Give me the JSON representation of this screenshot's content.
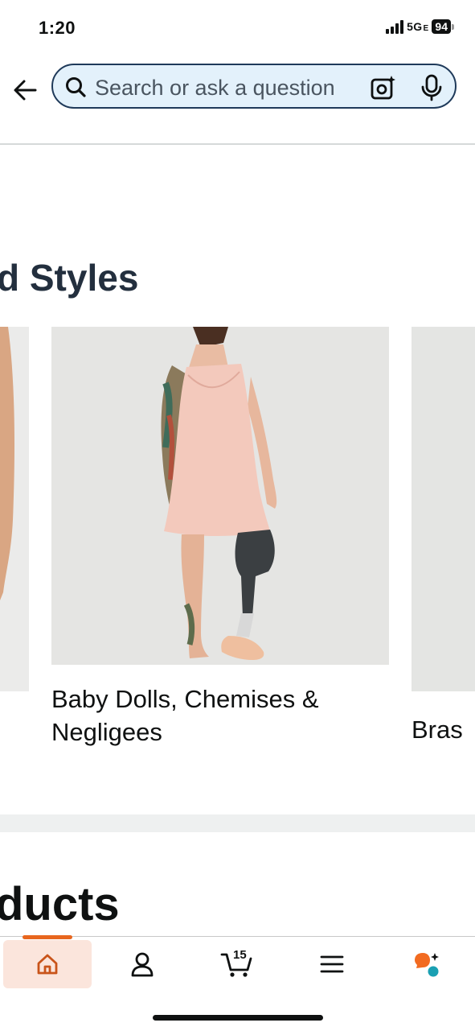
{
  "status_bar": {
    "time": "1:20",
    "network": "5G",
    "network_suffix": "E",
    "battery": "94"
  },
  "search": {
    "placeholder": "Search or ask a question",
    "accent": "#1f3a5a",
    "background": "#e3f1fb"
  },
  "sections": {
    "styles_title": "d Styles",
    "products_title": "ducts"
  },
  "carousel": {
    "items": [
      {
        "label": "Baby Dolls, Chemises & Negligees",
        "icon": "sleepwear-product-image"
      },
      {
        "label": "Bras",
        "icon": "bras-product-image"
      }
    ]
  },
  "bottom_nav": {
    "items": [
      {
        "name": "home",
        "icon": "home-icon",
        "active": true
      },
      {
        "name": "account",
        "icon": "person-icon"
      },
      {
        "name": "cart",
        "icon": "cart-icon"
      },
      {
        "name": "menu",
        "icon": "menu-icon"
      },
      {
        "name": "rufus",
        "icon": "ai-assistant-icon"
      }
    ],
    "cart_count": "15",
    "active_color": "#e8661e"
  }
}
